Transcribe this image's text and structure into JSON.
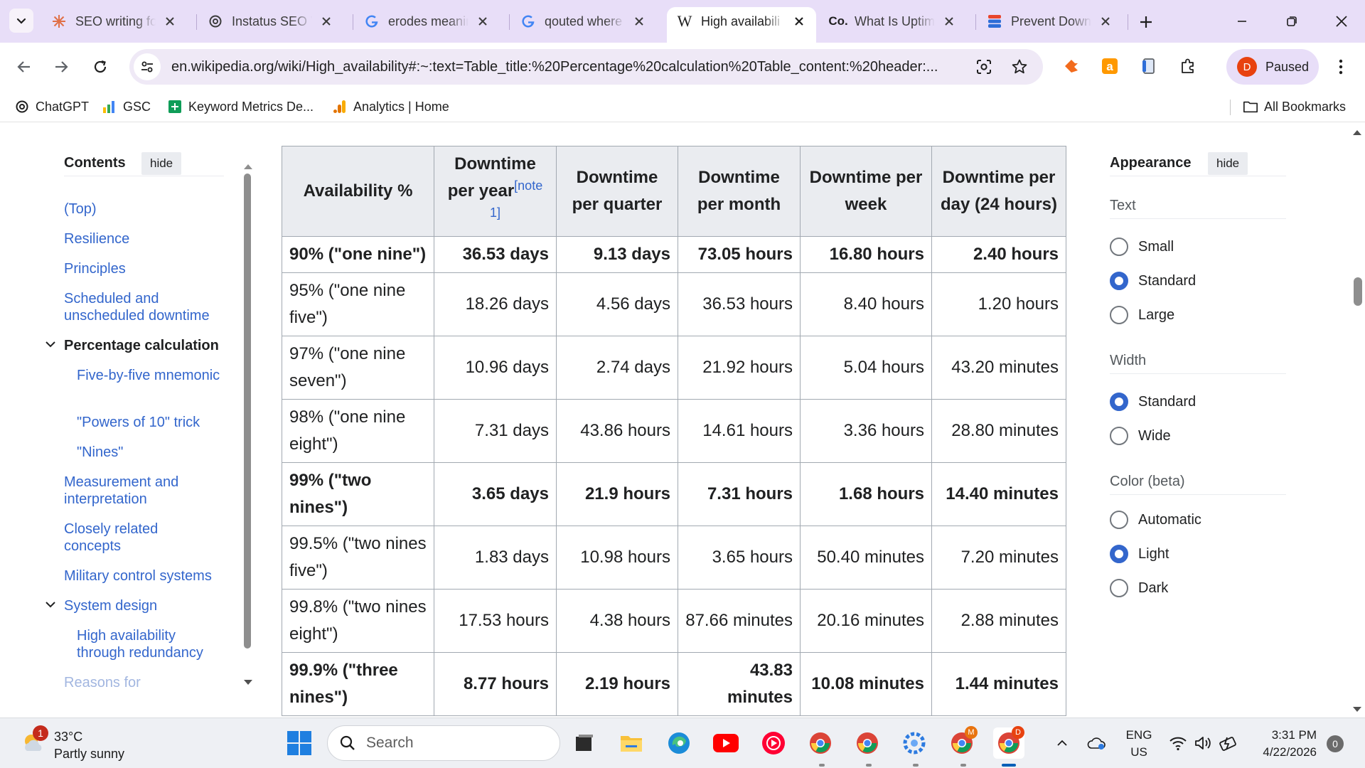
{
  "browser": {
    "tabs": [
      {
        "title": "SEO writing fo",
        "icon": "openai-icon",
        "active": false
      },
      {
        "title": "Instatus SEO V",
        "icon": "openai-icon",
        "active": false
      },
      {
        "title": "erodes meanin",
        "icon": "google-icon",
        "active": false
      },
      {
        "title": "qouted where",
        "icon": "google-icon",
        "active": false
      },
      {
        "title": "High availabili",
        "icon": "wikipedia-icon",
        "active": true
      },
      {
        "title": "What Is Uptim",
        "icon": "co-icon",
        "active": false
      },
      {
        "title": "Prevent Down",
        "icon": "stack-icon",
        "active": false
      }
    ],
    "url": "en.wikipedia.org/wiki/High_availability#:~:text=Table_title:%20Percentage%20calculation%20Table_content:%20header:...",
    "profile_initial": "D",
    "profile_status": "Paused",
    "bookmarks": [
      {
        "label": "ChatGPT",
        "icon": "openai-icon"
      },
      {
        "label": "GSC",
        "icon": "search-console-icon"
      },
      {
        "label": "Keyword Metrics De...",
        "icon": "sheets-icon"
      },
      {
        "label": "Analytics | Home",
        "icon": "analytics-icon"
      }
    ],
    "all_bookmarks_label": "All Bookmarks"
  },
  "toc": {
    "title": "Contents",
    "hide_label": "hide",
    "items": [
      {
        "label": "(Top)"
      },
      {
        "label": "Resilience"
      },
      {
        "label": "Principles"
      },
      {
        "label": "Scheduled and unscheduled downtime"
      },
      {
        "label": "Percentage calculation"
      },
      {
        "label": "Five-by-five mnemonic"
      },
      {
        "label": "\"Powers of 10\" trick"
      },
      {
        "label": "\"Nines\""
      },
      {
        "label": "Measurement and interpretation"
      },
      {
        "label": "Closely related concepts"
      },
      {
        "label": "Military control systems"
      },
      {
        "label": "System design"
      },
      {
        "label": "High availability through redundancy"
      },
      {
        "label": "Reasons for"
      }
    ]
  },
  "table": {
    "headers": [
      "Availability %",
      "Downtime per year",
      "Downtime per quarter",
      "Downtime per month",
      "Downtime per week",
      "Downtime per day (24 hours)"
    ],
    "note": "[note 1]",
    "rows": [
      {
        "bold": true,
        "cells": [
          "90% (\"one nine\")",
          "36.53 days",
          "9.13 days",
          "73.05 hours",
          "16.80 hours",
          "2.40 hours"
        ]
      },
      {
        "bold": false,
        "cells": [
          "95% (\"one nine five\")",
          "18.26 days",
          "4.56 days",
          "36.53 hours",
          "8.40 hours",
          "1.20 hours"
        ]
      },
      {
        "bold": false,
        "cells": [
          "97% (\"one nine seven\")",
          "10.96 days",
          "2.74 days",
          "21.92 hours",
          "5.04 hours",
          "43.20 minutes"
        ]
      },
      {
        "bold": false,
        "cells": [
          "98% (\"one nine eight\")",
          "7.31 days",
          "43.86 hours",
          "14.61 hours",
          "3.36 hours",
          "28.80 minutes"
        ]
      },
      {
        "bold": true,
        "cells": [
          "99% (\"two nines\")",
          "3.65 days",
          "21.9 hours",
          "7.31 hours",
          "1.68 hours",
          "14.40 minutes"
        ]
      },
      {
        "bold": false,
        "cells": [
          "99.5% (\"two nines five\")",
          "1.83 days",
          "10.98 hours",
          "3.65 hours",
          "50.40 minutes",
          "7.20 minutes"
        ]
      },
      {
        "bold": false,
        "cells": [
          "99.8% (\"two nines eight\")",
          "17.53 hours",
          "4.38 hours",
          "87.66 minutes",
          "20.16 minutes",
          "2.88 minutes"
        ]
      },
      {
        "bold": true,
        "cells": [
          "99.9% (\"three nines\")",
          "8.77 hours",
          "2.19 hours",
          "43.83 minutes",
          "10.08 minutes",
          "1.44 minutes"
        ]
      }
    ]
  },
  "appearance": {
    "title": "Appearance",
    "hide_label": "hide",
    "groups": [
      {
        "label": "Text",
        "options": [
          {
            "label": "Small",
            "selected": false
          },
          {
            "label": "Standard",
            "selected": true
          },
          {
            "label": "Large",
            "selected": false
          }
        ]
      },
      {
        "label": "Width",
        "options": [
          {
            "label": "Standard",
            "selected": true
          },
          {
            "label": "Wide",
            "selected": false
          }
        ]
      },
      {
        "label": "Color (beta)",
        "options": [
          {
            "label": "Automatic",
            "selected": false
          },
          {
            "label": "Light",
            "selected": true
          },
          {
            "label": "Dark",
            "selected": false
          }
        ]
      }
    ]
  },
  "taskbar": {
    "weather_temp": "33°C",
    "weather_cond": "Partly sunny",
    "weather_badge": "1",
    "search_label": "Search",
    "lang_line1": "ENG",
    "lang_line2": "US",
    "time": "3:31 PM",
    "date": "4/22/2026",
    "notification_count": "0",
    "chrome_profile_badges": [
      "M",
      "D"
    ]
  },
  "colors": {
    "tabstrip_bg": "#e8def8",
    "link": "#3366cc",
    "header_bg": "#eaecf0",
    "profile_accent": "#e8420f"
  }
}
